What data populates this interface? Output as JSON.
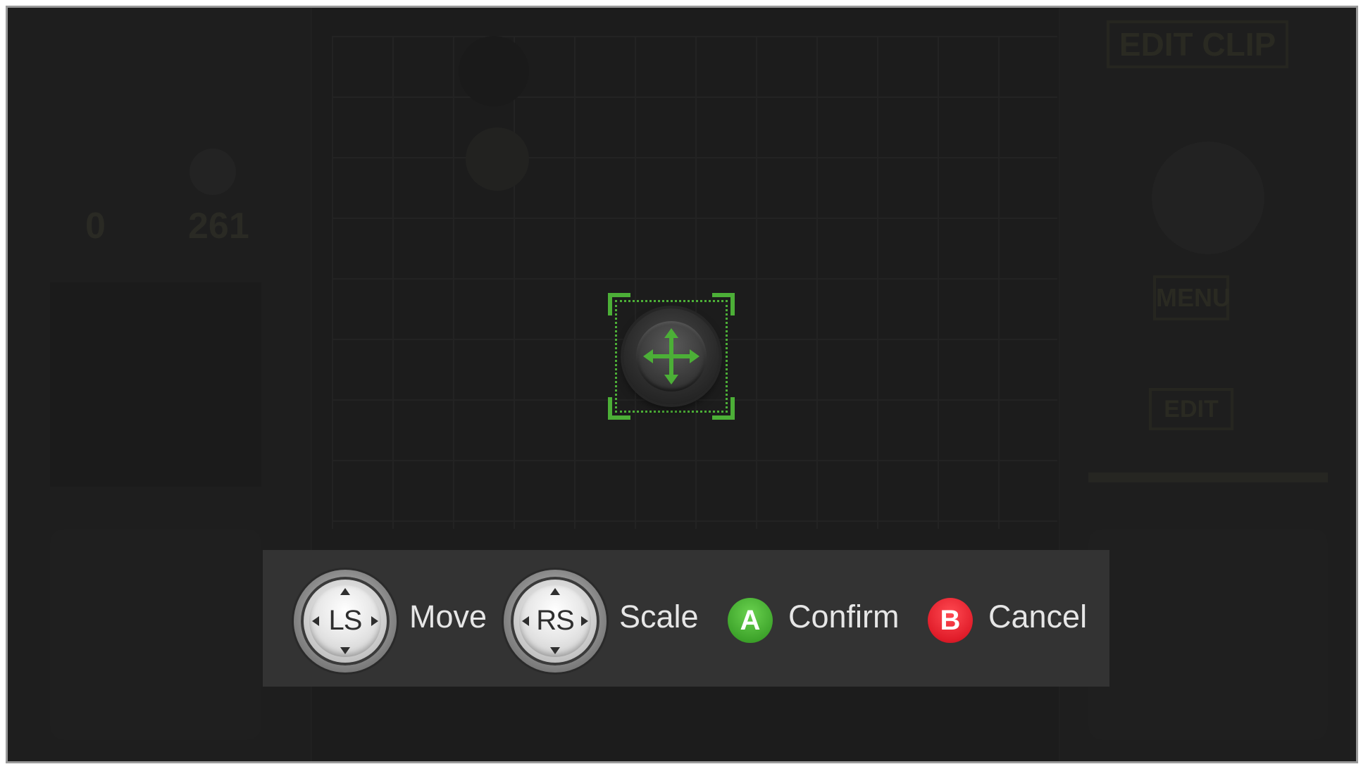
{
  "background": {
    "top_right_button": "EDIT CLIP",
    "menu_button": "MENU",
    "edit_button": "EDIT",
    "counter_left": "0",
    "counter_right": "261"
  },
  "hints": [
    {
      "control": "LS",
      "label": "Move"
    },
    {
      "control": "RS",
      "label": "Scale"
    },
    {
      "control": "A",
      "label": "Confirm"
    },
    {
      "control": "B",
      "label": "Cancel"
    }
  ],
  "colors": {
    "selection_green": "#4caf37",
    "button_a": "#3fa52c",
    "button_b": "#e11d2a",
    "hint_bar": "#333333"
  },
  "icons": {
    "selection": "move-arrows-icon",
    "left_stick": "left-stick-icon",
    "right_stick": "right-stick-icon"
  }
}
